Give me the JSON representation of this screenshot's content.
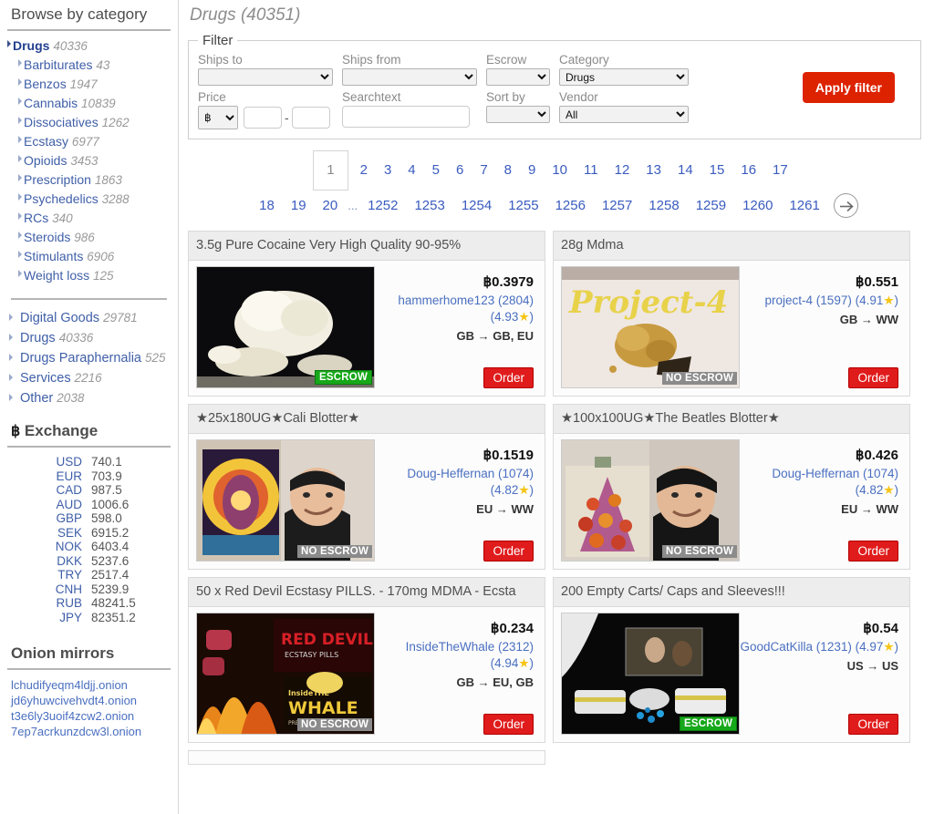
{
  "sidebar": {
    "browse_heading": "Browse by category",
    "categories": [
      {
        "label": "Drugs",
        "count": "40336",
        "top": true
      },
      {
        "label": "Barbiturates",
        "count": "43",
        "top": false
      },
      {
        "label": "Benzos",
        "count": "1947",
        "top": false
      },
      {
        "label": "Cannabis",
        "count": "10839",
        "top": false
      },
      {
        "label": "Dissociatives",
        "count": "1262",
        "top": false
      },
      {
        "label": "Ecstasy",
        "count": "6977",
        "top": false
      },
      {
        "label": "Opioids",
        "count": "3453",
        "top": false
      },
      {
        "label": "Prescription",
        "count": "1863",
        "top": false
      },
      {
        "label": "Psychedelics",
        "count": "3288",
        "top": false
      },
      {
        "label": "RCs",
        "count": "340",
        "top": false
      },
      {
        "label": "Steroids",
        "count": "986",
        "top": false
      },
      {
        "label": "Stimulants",
        "count": "6906",
        "top": false
      },
      {
        "label": "Weight loss",
        "count": "125",
        "top": false
      }
    ],
    "top_categories": [
      {
        "label": "Digital Goods",
        "count": "29781"
      },
      {
        "label": "Drugs",
        "count": "40336"
      },
      {
        "label": "Drugs Paraphernalia",
        "count": "525"
      },
      {
        "label": "Services",
        "count": "2216"
      },
      {
        "label": "Other",
        "count": "2038"
      }
    ],
    "exchange_heading": "Exchange",
    "exchange_symbol": "฿",
    "rates": [
      {
        "currency": "USD",
        "value": "740.1"
      },
      {
        "currency": "EUR",
        "value": "703.9"
      },
      {
        "currency": "CAD",
        "value": "987.5"
      },
      {
        "currency": "AUD",
        "value": "1006.6"
      },
      {
        "currency": "GBP",
        "value": "598.0"
      },
      {
        "currency": "SEK",
        "value": "6915.2"
      },
      {
        "currency": "NOK",
        "value": "6403.4"
      },
      {
        "currency": "DKK",
        "value": "5237.6"
      },
      {
        "currency": "TRY",
        "value": "2517.4"
      },
      {
        "currency": "CNH",
        "value": "5239.9"
      },
      {
        "currency": "RUB",
        "value": "48241.5"
      },
      {
        "currency": "JPY",
        "value": "82351.2"
      }
    ],
    "mirrors_heading": "Onion mirrors",
    "mirrors": [
      "lchudifyeqm4ldjj.onion",
      "jd6yhuwcivehvdt4.onion",
      "t3e6ly3uoif4zcw2.onion",
      "7ep7acrkunzdcw3l.onion"
    ]
  },
  "main": {
    "page_title": "Drugs (40351)",
    "filter": {
      "legend": "Filter",
      "ships_to_label": "Ships to",
      "ships_to_value": "",
      "ships_from_label": "Ships from",
      "ships_from_value": "",
      "escrow_label": "Escrow",
      "escrow_value": "",
      "category_label": "Category",
      "category_value": "Drugs",
      "price_label": "Price",
      "price_currency": "฿",
      "price_min": "",
      "price_max": "",
      "price_separator": "-",
      "searchtext_label": "Searchtext",
      "searchtext_value": "",
      "sort_by_label": "Sort by",
      "sort_by_value": "",
      "vendor_label": "Vendor",
      "vendor_value": "All",
      "apply_label": "Apply filter",
      "apply_color": "#dd2200"
    },
    "pagination": {
      "current": "1",
      "row1": [
        "2",
        "3",
        "4",
        "5",
        "6",
        "7",
        "8",
        "9",
        "10",
        "11",
        "12",
        "13",
        "14",
        "15",
        "16",
        "17"
      ],
      "row2_pre": [
        "18",
        "19",
        "20"
      ],
      "ellipsis": "...",
      "row2_post": [
        "1252",
        "1253",
        "1254",
        "1255",
        "1256",
        "1257",
        "1258",
        "1259",
        "1260",
        "1261"
      ],
      "next_icon": "arrow-right-icon"
    },
    "listings": [
      {
        "title": "3.5g Pure Cocaine Very High Quality 90-95%",
        "price": "0.3979",
        "currency_symbol": "฿",
        "vendor": "hammerhome123 (2804)",
        "rating": "(4.93",
        "rating_close": ")",
        "shipping": "GB → GB, EU",
        "escrow": "ESCROW",
        "escrow_type": "yes",
        "order_label": "Order",
        "image": "cocaine-rock-photo"
      },
      {
        "title": "28g Mdma",
        "price": "0.551",
        "currency_symbol": "฿",
        "vendor": "project-4 (1597)",
        "rating": "(4.91",
        "rating_close": ")",
        "shipping": "GB → WW",
        "escrow": "NO ESCROW",
        "escrow_type": "no",
        "order_label": "Order",
        "image": "mdma-crystal-photo"
      },
      {
        "title": "★25x180UG★Cali Blotter★",
        "price": "0.1519",
        "currency_symbol": "฿",
        "vendor": "Doug-Heffernan (1074)",
        "rating": "(4.82",
        "rating_close": ")",
        "shipping": "EU → WW",
        "escrow": "NO ESCROW",
        "escrow_type": "no",
        "order_label": "Order",
        "image": "blotter-art-photo"
      },
      {
        "title": "★100x100UG★The Beatles Blotter★",
        "price": "0.426",
        "currency_symbol": "฿",
        "vendor": "Doug-Heffernan (1074)",
        "rating": "(4.82",
        "rating_close": ")",
        "shipping": "EU → WW",
        "escrow": "NO ESCROW",
        "escrow_type": "no",
        "order_label": "Order",
        "image": "beatles-blotter-photo"
      },
      {
        "title": "50 x Red Devil Ecstasy PILLS. - 170mg MDMA - Ecsta",
        "price": "0.234",
        "currency_symbol": "฿",
        "vendor": "InsideTheWhale (2312)",
        "rating": "(4.94",
        "rating_close": ")",
        "shipping": "GB → EU, GB",
        "escrow": "NO ESCROW",
        "escrow_type": "no",
        "order_label": "Order",
        "image": "red-devils-flyer-photo"
      },
      {
        "title": "200 Empty Carts/ Caps and Sleeves!!!",
        "price": "0.54",
        "currency_symbol": "฿",
        "vendor": "GoodCatKilla (1231)",
        "rating": "(4.97",
        "rating_close": ")",
        "shipping": "US → US",
        "escrow": "ESCROW",
        "escrow_type": "yes",
        "order_label": "Order",
        "image": "empty-carts-photo"
      }
    ]
  }
}
